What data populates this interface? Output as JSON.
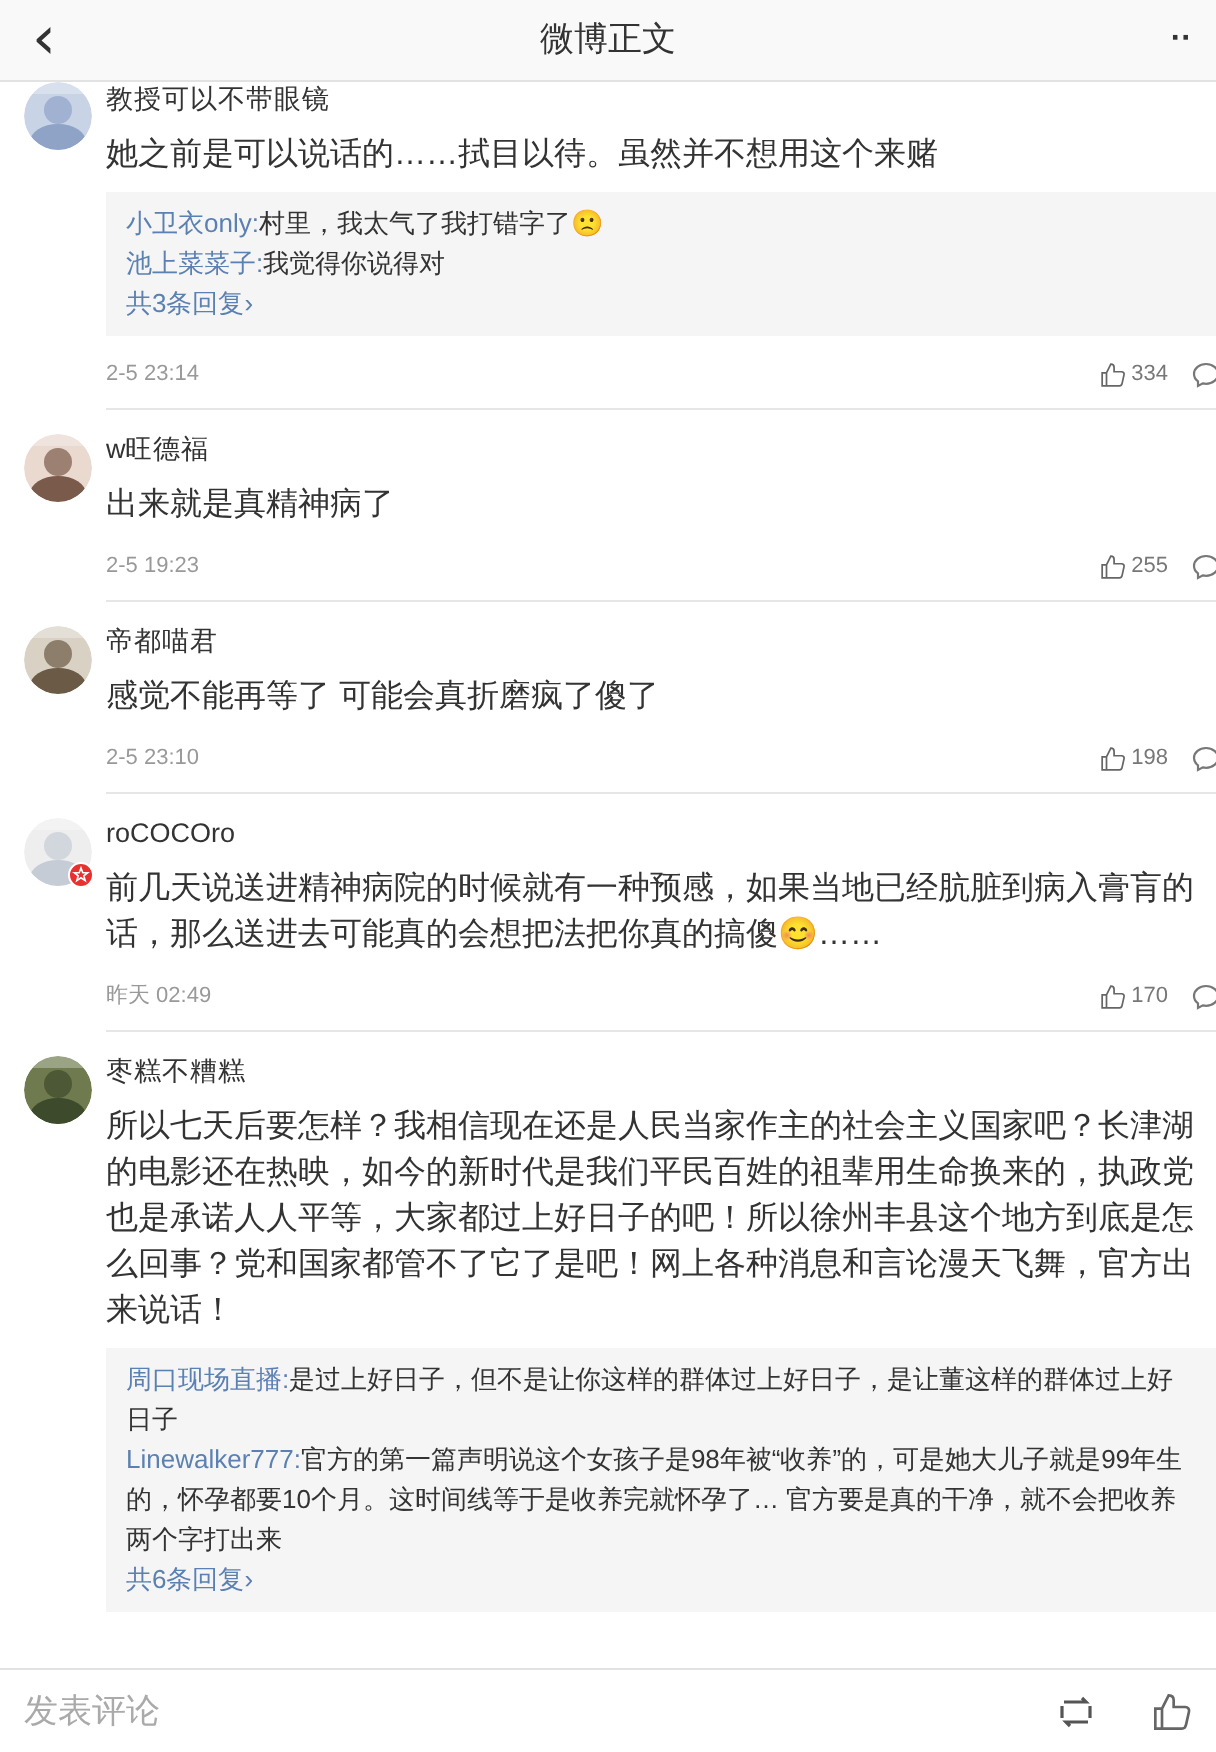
{
  "header": {
    "back": "‹",
    "title": "微博正文",
    "more": "··"
  },
  "comments": [
    {
      "user": "教授可以不带眼镜",
      "verified": false,
      "text": "她之前是可以说话的……拭目以待。虽然并不想用这个来赌",
      "replies": [
        {
          "user": "小卫衣only:",
          "text": "村里，我太气了我打错字了🙁"
        },
        {
          "user": "池上菜菜子:",
          "text": "我觉得你说得对"
        }
      ],
      "more": "共3条回复›",
      "time": "2-5 23:14",
      "likes": "334"
    },
    {
      "user": "w旺德福",
      "verified": false,
      "text": "出来就是真精神病了",
      "time": "2-5 19:23",
      "likes": "255"
    },
    {
      "user": "帝都喵君",
      "verified": false,
      "text": "感觉不能再等了 可能会真折磨疯了傻了",
      "time": "2-5 23:10",
      "likes": "198"
    },
    {
      "user": "roCOCOro",
      "verified": true,
      "text": "前几天说送进精神病院的时候就有一种预感，如果当地已经肮脏到病入膏肓的话，那么送进去可能真的会想把法把你真的搞傻😊……",
      "time": "昨天 02:49",
      "likes": "170"
    },
    {
      "user": "枣糕不糟糕",
      "verified": false,
      "text": "所以七天后要怎样？我相信现在还是人民当家作主的社会主义国家吧？长津湖的电影还在热映，如今的新时代是我们平民百姓的祖辈用生命换来的，执政党也是承诺人人平等，大家都过上好日子的吧！所以徐州丰县这个地方到底是怎么回事？党和国家都管不了它了是吧！网上各种消息和言论漫天飞舞，官方出来说话！",
      "replies": [
        {
          "user": "周口现场直播:",
          "text": "是过上好日子，但不是让你这样的群体过上好日子，是让董这样的群体过上好日子"
        },
        {
          "user": "Linewalker777:",
          "text": "官方的第一篇声明说这个女孩子是98年被“收养”的，可是她大儿子就是99年生的，怀孕都要10个月。这时间线等于是收养完就怀孕了… 官方要是真的干净，就不会把收养两个字打出来"
        }
      ],
      "more": "共6条回复›"
    }
  ],
  "footer": {
    "placeholder": "发表评论"
  }
}
